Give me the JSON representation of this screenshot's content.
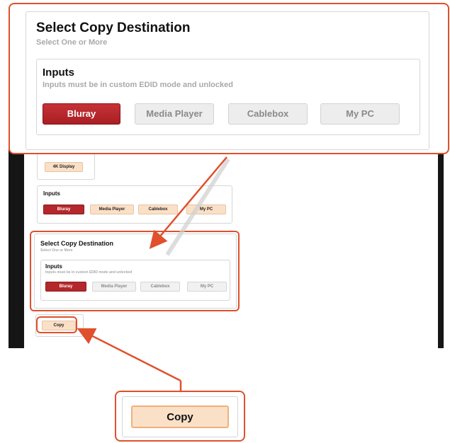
{
  "top_zoom": {
    "title": "Select Copy Destination",
    "subtitle": "Select One or More",
    "inputs_title": "Inputs",
    "inputs_note": "Inputs must be in custom EDID mode and unlocked",
    "buttons": [
      "Bluray",
      "Media Player",
      "Cablebox",
      "My PC"
    ]
  },
  "screen": {
    "display_button": "4K Display",
    "inputs_panel": {
      "title": "Inputs",
      "buttons": [
        "Bluray",
        "Media Player",
        "Cablebox",
        "My PC"
      ]
    },
    "dest_panel": {
      "title": "Select Copy Destination",
      "subtitle": "Select One or More",
      "inputs_title": "Inputs",
      "inputs_note": "Inputs must be in custom EDID mode and unlocked",
      "buttons": [
        "Bluray",
        "Media Player",
        "Cablebox",
        "My PC"
      ]
    },
    "copy_button": "Copy"
  },
  "bottom_zoom": {
    "copy_button": "Copy"
  },
  "colors": {
    "accent": "#e0502c",
    "selected": "#b4272b",
    "peach": "#fbe0c8"
  }
}
